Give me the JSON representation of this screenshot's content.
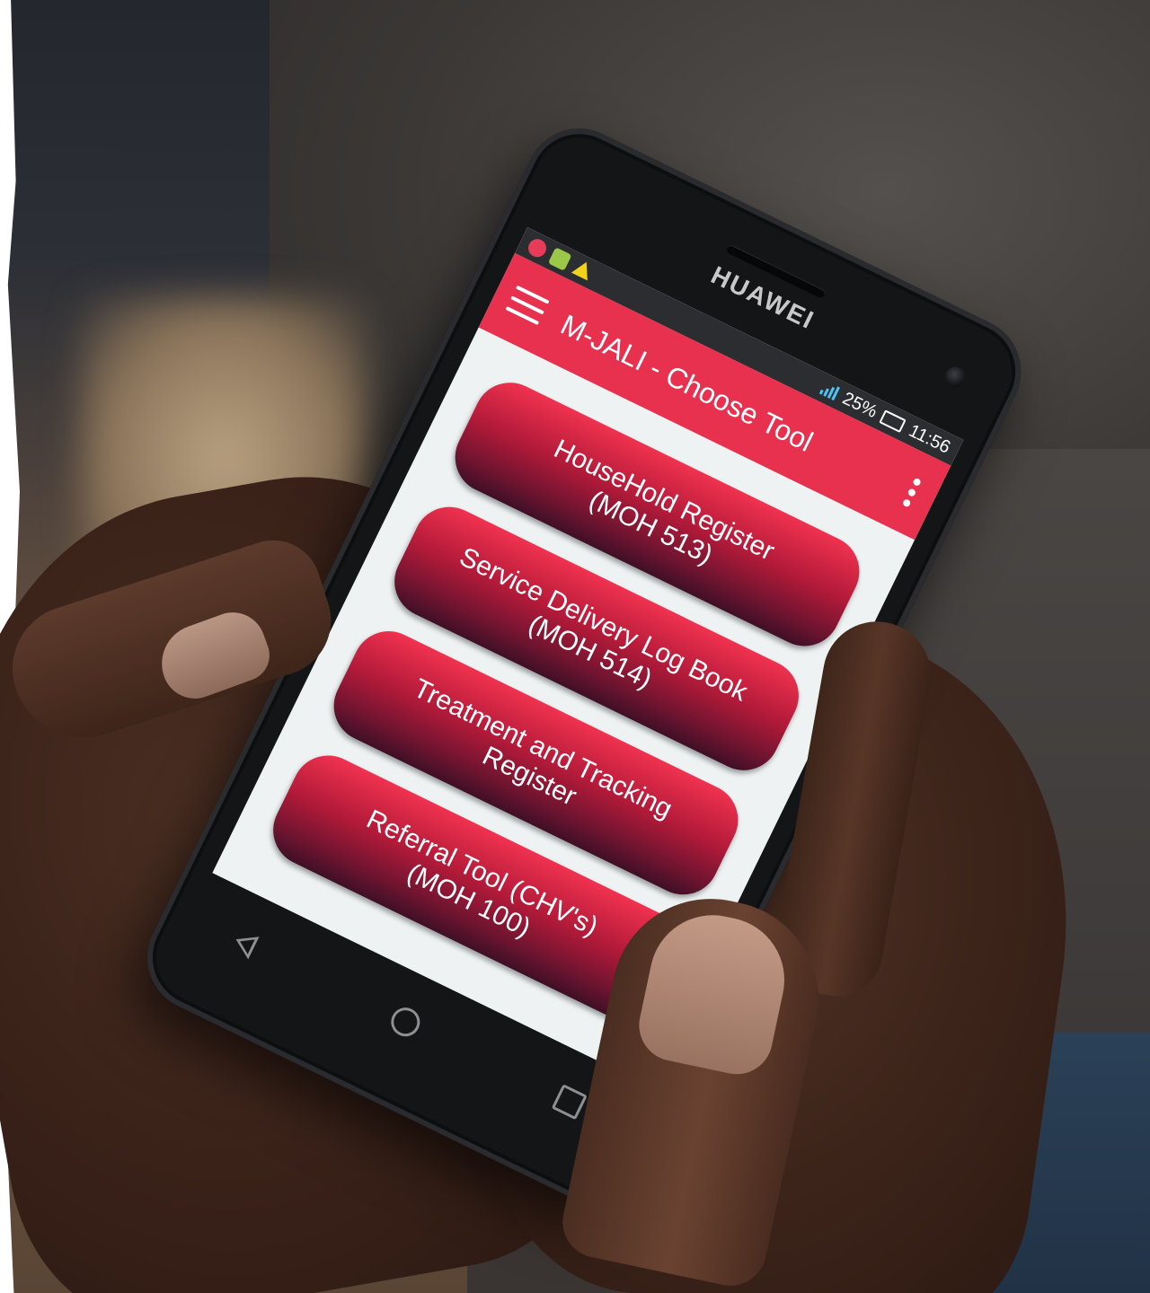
{
  "device": {
    "brand": "HUAWEI"
  },
  "status_bar": {
    "battery_percent": "25%",
    "time": "11:56",
    "signal_icon": "signal-icon",
    "battery_icon": "battery-icon"
  },
  "app_bar": {
    "title": "M-JALI - Choose Tool",
    "menu_icon": "hamburger-menu-icon",
    "overflow_icon": "more-vertical-icon",
    "color": "#e8304f"
  },
  "tools": [
    {
      "label": "HouseHold Register\n(MOH 513)"
    },
    {
      "label": "Service Delivery Log Book\n(MOH 514)"
    },
    {
      "label": "Treatment and Tracking\nRegister"
    },
    {
      "label": "Referral Tool (CHV's)\n(MOH 100)"
    }
  ],
  "nav_bar": {
    "back_icon": "back-triangle-icon",
    "home_icon": "home-circle-icon",
    "recents_icon": "recents-square-icon"
  },
  "colors": {
    "button_top": "#f0324f",
    "button_bottom": "#3f1025",
    "screen_background": "#eef2f3"
  }
}
